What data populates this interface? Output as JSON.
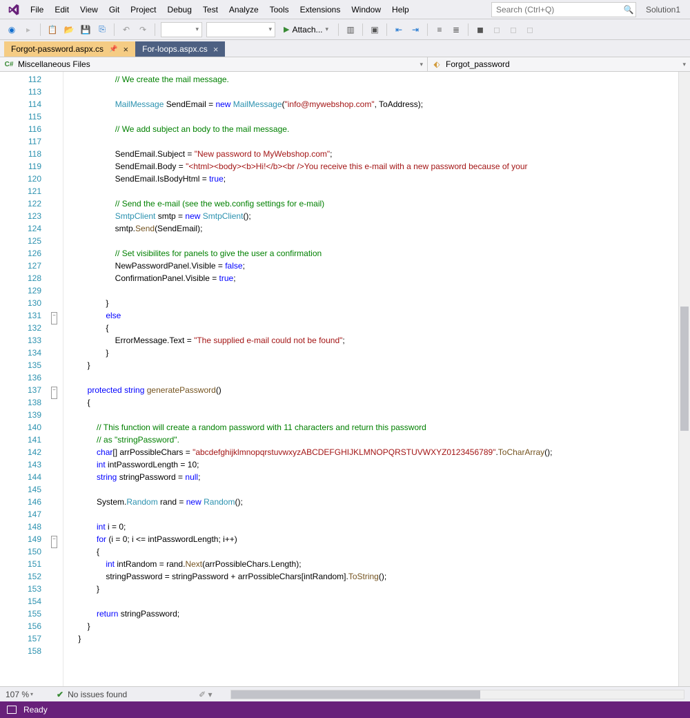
{
  "menu": [
    "File",
    "Edit",
    "View",
    "Git",
    "Project",
    "Debug",
    "Test",
    "Analyze",
    "Tools",
    "Extensions",
    "Window",
    "Help"
  ],
  "search_placeholder": "Search (Ctrl+Q)",
  "solution": "Solution1",
  "attach_label": "Attach...",
  "tabs": [
    {
      "label": "Forgot-password.aspx.cs",
      "active": true,
      "pinned": true
    },
    {
      "label": "For-loops.aspx.cs",
      "active": false,
      "pinned": false
    }
  ],
  "nav_left": "Miscellaneous Files",
  "nav_right": "Forgot_password",
  "line_start": 112,
  "line_end": 158,
  "fold_lines": [
    131,
    137,
    149
  ],
  "code": [
    {
      "i": "                    ",
      "t": [
        {
          "c": "c-comment",
          "s": "// We create the mail message."
        }
      ]
    },
    {
      "i": "",
      "t": []
    },
    {
      "i": "                    ",
      "t": [
        {
          "c": "c-type",
          "s": "MailMessage"
        },
        {
          "s": " SendEmail = "
        },
        {
          "c": "c-keyword",
          "s": "new"
        },
        {
          "s": " "
        },
        {
          "c": "c-type",
          "s": "MailMessage"
        },
        {
          "s": "("
        },
        {
          "c": "c-string",
          "s": "\"info@mywebshop.com\""
        },
        {
          "s": ", ToAddress);"
        }
      ]
    },
    {
      "i": "",
      "t": []
    },
    {
      "i": "                    ",
      "t": [
        {
          "c": "c-comment",
          "s": "// We add subject an body to the mail message."
        }
      ]
    },
    {
      "i": "",
      "t": []
    },
    {
      "i": "                    ",
      "t": [
        {
          "s": "SendEmail.Subject = "
        },
        {
          "c": "c-string",
          "s": "\"New password to MyWebshop.com\""
        },
        {
          "s": ";"
        }
      ]
    },
    {
      "i": "                    ",
      "t": [
        {
          "s": "SendEmail.Body = "
        },
        {
          "c": "c-string",
          "s": "\"<html><body><b>Hi!</b><br />You receive this e-mail with a new password because of your"
        }
      ]
    },
    {
      "i": "                    ",
      "t": [
        {
          "s": "SendEmail.IsBodyHtml = "
        },
        {
          "c": "c-keyword",
          "s": "true"
        },
        {
          "s": ";"
        }
      ]
    },
    {
      "i": "",
      "t": []
    },
    {
      "i": "                    ",
      "t": [
        {
          "c": "c-comment",
          "s": "// Send the e-mail (see the web.config settings for e-mail)"
        }
      ]
    },
    {
      "i": "                    ",
      "t": [
        {
          "c": "c-type",
          "s": "SmtpClient"
        },
        {
          "s": " smtp = "
        },
        {
          "c": "c-keyword",
          "s": "new"
        },
        {
          "s": " "
        },
        {
          "c": "c-type",
          "s": "SmtpClient"
        },
        {
          "s": "();"
        }
      ]
    },
    {
      "i": "                    ",
      "t": [
        {
          "s": "smtp."
        },
        {
          "c": "c-method",
          "s": "Send"
        },
        {
          "s": "(SendEmail);"
        }
      ]
    },
    {
      "i": "",
      "t": []
    },
    {
      "i": "                    ",
      "t": [
        {
          "c": "c-comment",
          "s": "// Set visibilites for panels to give the user a confirmation"
        }
      ]
    },
    {
      "i": "                    ",
      "t": [
        {
          "s": "NewPasswordPanel.Visible = "
        },
        {
          "c": "c-keyword",
          "s": "false"
        },
        {
          "s": ";"
        }
      ]
    },
    {
      "i": "                    ",
      "t": [
        {
          "s": "ConfirmationPanel.Visible = "
        },
        {
          "c": "c-keyword",
          "s": "true"
        },
        {
          "s": ";"
        }
      ]
    },
    {
      "i": "",
      "t": []
    },
    {
      "i": "                ",
      "t": [
        {
          "s": "}"
        }
      ]
    },
    {
      "i": "                ",
      "t": [
        {
          "c": "c-keyword",
          "s": "else"
        }
      ]
    },
    {
      "i": "                ",
      "t": [
        {
          "s": "{"
        }
      ]
    },
    {
      "i": "                    ",
      "t": [
        {
          "s": "ErrorMessage.Text = "
        },
        {
          "c": "c-string",
          "s": "\"The supplied e-mail could not be found\""
        },
        {
          "s": ";"
        }
      ]
    },
    {
      "i": "                ",
      "t": [
        {
          "s": "}"
        }
      ]
    },
    {
      "i": "        ",
      "t": [
        {
          "s": "}"
        }
      ]
    },
    {
      "i": "",
      "t": []
    },
    {
      "i": "        ",
      "t": [
        {
          "c": "c-keyword",
          "s": "protected"
        },
        {
          "s": " "
        },
        {
          "c": "c-keyword",
          "s": "string"
        },
        {
          "s": " "
        },
        {
          "c": "c-method",
          "s": "generatePassword"
        },
        {
          "s": "()"
        }
      ]
    },
    {
      "i": "        ",
      "t": [
        {
          "s": "{"
        }
      ]
    },
    {
      "i": "",
      "t": []
    },
    {
      "i": "            ",
      "t": [
        {
          "c": "c-comment",
          "s": "// This function will create a random password with 11 characters and return this password"
        }
      ]
    },
    {
      "i": "            ",
      "t": [
        {
          "c": "c-comment",
          "s": "// as \"stringPassword\"."
        }
      ]
    },
    {
      "i": "            ",
      "t": [
        {
          "c": "c-keyword",
          "s": "char"
        },
        {
          "s": "[] arrPossibleChars = "
        },
        {
          "c": "c-string",
          "s": "\"abcdefghijklmnopqrstuvwxyzABCDEFGHIJKLMNOPQRSTUVWXYZ0123456789\""
        },
        {
          "s": "."
        },
        {
          "c": "c-method",
          "s": "ToCharArray"
        },
        {
          "s": "();"
        }
      ]
    },
    {
      "i": "            ",
      "t": [
        {
          "c": "c-keyword",
          "s": "int"
        },
        {
          "s": " intPasswordLength = 10;"
        }
      ]
    },
    {
      "i": "            ",
      "t": [
        {
          "c": "c-keyword",
          "s": "string"
        },
        {
          "s": " stringPassword = "
        },
        {
          "c": "c-keyword",
          "s": "null"
        },
        {
          "s": ";"
        }
      ]
    },
    {
      "i": "",
      "t": []
    },
    {
      "i": "            ",
      "t": [
        {
          "s": "System."
        },
        {
          "c": "c-type",
          "s": "Random"
        },
        {
          "s": " rand = "
        },
        {
          "c": "c-keyword",
          "s": "new"
        },
        {
          "s": " "
        },
        {
          "c": "c-type",
          "s": "Random"
        },
        {
          "s": "();"
        }
      ]
    },
    {
      "i": "",
      "t": []
    },
    {
      "i": "            ",
      "t": [
        {
          "c": "c-keyword",
          "s": "int"
        },
        {
          "s": " i = 0;"
        }
      ]
    },
    {
      "i": "            ",
      "t": [
        {
          "c": "c-keyword",
          "s": "for"
        },
        {
          "s": " (i = 0; i <= intPasswordLength; i++)"
        }
      ]
    },
    {
      "i": "            ",
      "t": [
        {
          "s": "{"
        }
      ]
    },
    {
      "i": "                ",
      "t": [
        {
          "c": "c-keyword",
          "s": "int"
        },
        {
          "s": " intRandom = rand."
        },
        {
          "c": "c-method",
          "s": "Next"
        },
        {
          "s": "(arrPossibleChars.Length);"
        }
      ]
    },
    {
      "i": "                ",
      "t": [
        {
          "s": "stringPassword = stringPassword + arrPossibleChars[intRandom]."
        },
        {
          "c": "c-method",
          "s": "ToString"
        },
        {
          "s": "();"
        }
      ]
    },
    {
      "i": "            ",
      "t": [
        {
          "s": "}"
        }
      ]
    },
    {
      "i": "",
      "t": []
    },
    {
      "i": "            ",
      "t": [
        {
          "c": "c-keyword",
          "s": "return"
        },
        {
          "s": " stringPassword;"
        }
      ]
    },
    {
      "i": "        ",
      "t": [
        {
          "s": "}"
        }
      ]
    },
    {
      "i": "    ",
      "t": [
        {
          "s": "}"
        }
      ]
    },
    {
      "i": "",
      "t": []
    }
  ],
  "zoom": "107 %",
  "issues": "No issues found",
  "status": "Ready"
}
